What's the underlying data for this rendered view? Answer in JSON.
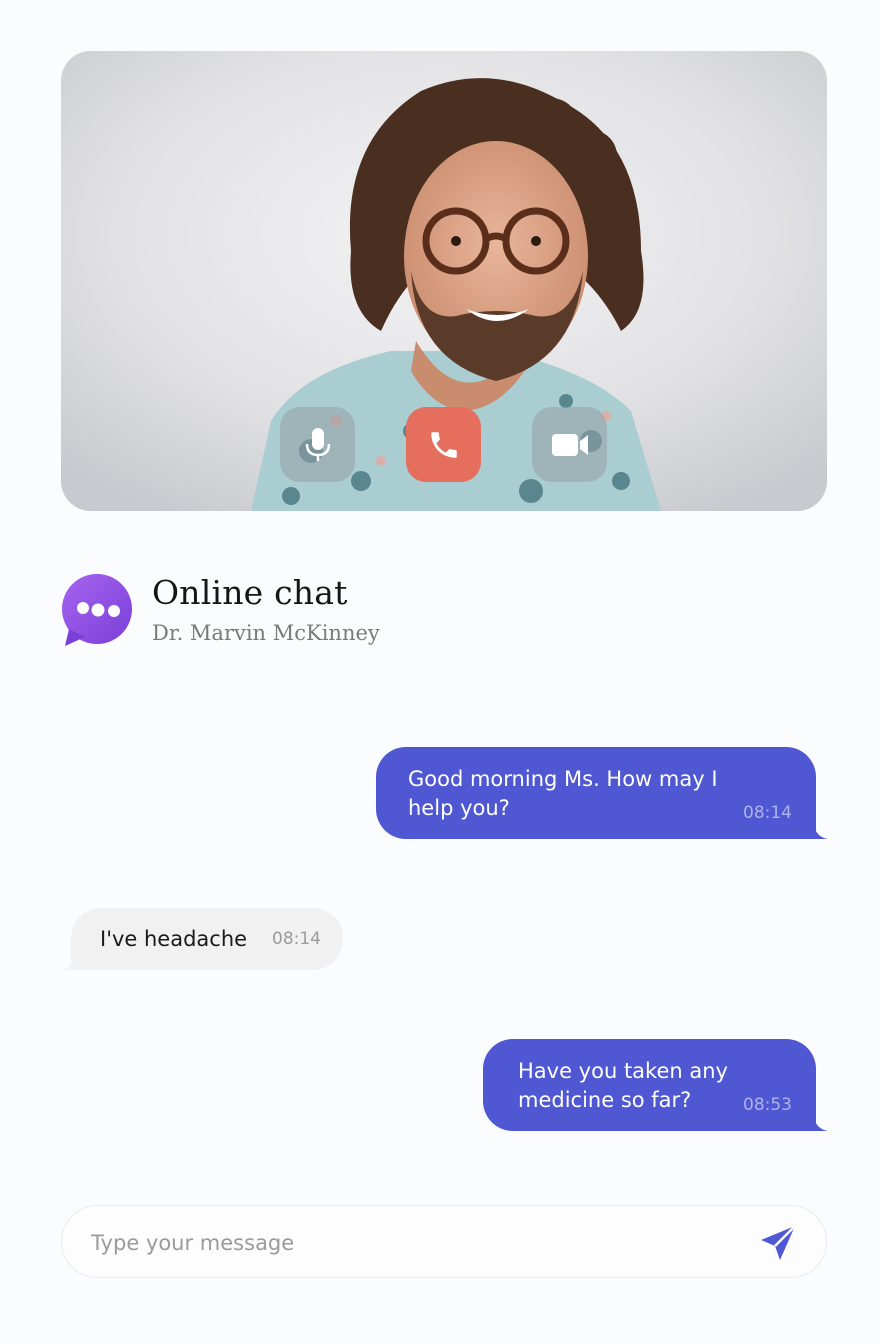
{
  "video_call": {
    "controls": {
      "mic_icon": "microphone-icon",
      "end_call_icon": "phone-icon",
      "video_icon": "video-camera-icon"
    },
    "colors": {
      "end_call": "#e56f5c",
      "glass": "rgba(150,160,165,0.55)"
    }
  },
  "chat": {
    "title": "Online chat",
    "subtitle": "Dr. Marvin McKinney",
    "icon": "chat-bubble-icon"
  },
  "messages": [
    {
      "direction": "out",
      "text": "Good morning Ms. How may I help you?",
      "time": "08:14"
    },
    {
      "direction": "in",
      "text": "I've headache",
      "time": "08:14"
    },
    {
      "direction": "out",
      "text": "Have you taken any medicine so far?",
      "time": "08:53"
    }
  ],
  "composer": {
    "placeholder": "Type your message",
    "value": "",
    "send_icon": "send-icon"
  },
  "colors": {
    "accent": "#4f57d2",
    "incoming_bubble": "#f1f1f2",
    "avatar_purple": "#8c4fe0",
    "background": "#fbfcfe"
  }
}
